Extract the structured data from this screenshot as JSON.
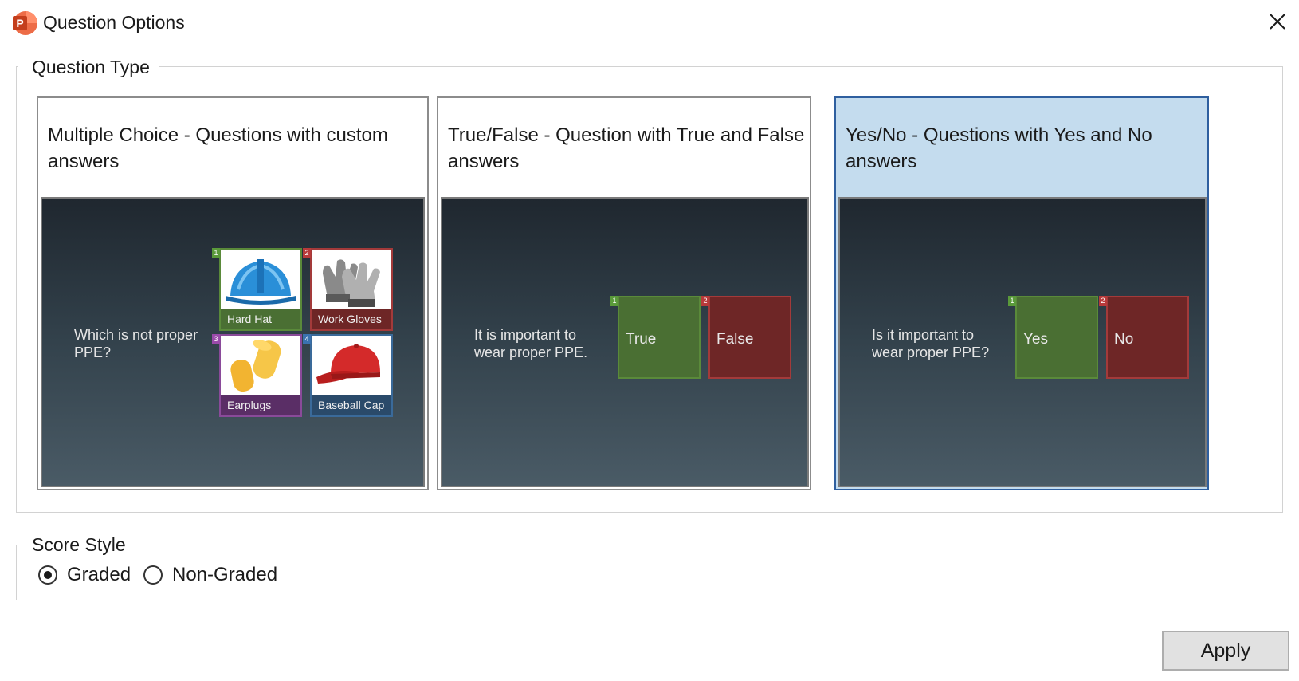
{
  "window": {
    "title": "Question Options",
    "app_icon": "powerpoint-icon",
    "app_icon_letter": "P",
    "close_icon": "close-icon"
  },
  "question_type": {
    "group_label": "Question Type",
    "options": [
      {
        "title": "Multiple Choice - Questions with custom answers",
        "selected": false,
        "preview": {
          "question": "Which is not proper PPE?",
          "answers": [
            {
              "number": "1",
              "label": "Hard Hat",
              "color": "green",
              "image": "hard-hat-image"
            },
            {
              "number": "2",
              "label": "Work Gloves",
              "color": "red",
              "image": "work-gloves-image"
            },
            {
              "number": "3",
              "label": "Earplugs",
              "color": "purple",
              "image": "earplugs-image"
            },
            {
              "number": "4",
              "label": "Baseball Cap",
              "color": "blue",
              "image": "baseball-cap-image"
            }
          ]
        }
      },
      {
        "title": "True/False - Question with True and False answers",
        "selected": false,
        "preview": {
          "question": "It is important to wear proper PPE.",
          "answers": [
            {
              "number": "1",
              "label": "True",
              "color": "green"
            },
            {
              "number": "2",
              "label": "False",
              "color": "red"
            }
          ]
        }
      },
      {
        "title": "Yes/No - Questions with Yes and No answers",
        "selected": true,
        "preview": {
          "question": "Is it important to wear proper PPE?",
          "answers": [
            {
              "number": "1",
              "label": "Yes",
              "color": "green"
            },
            {
              "number": "2",
              "label": "No",
              "color": "red"
            }
          ]
        }
      }
    ]
  },
  "score_style": {
    "group_label": "Score Style",
    "options": [
      {
        "label": "Graded",
        "checked": true
      },
      {
        "label": "Non-Graded",
        "checked": false
      }
    ]
  },
  "apply_label": "Apply",
  "colors": {
    "selected_card_bg": "#c4dcee",
    "selected_card_border": "#2f5f9f",
    "tile_green": "#4a6f33",
    "tile_red": "#6e2626",
    "tile_purple": "#5a2e66",
    "tile_blue": "#2a4a6a",
    "powerpoint_orange": "#d24726"
  }
}
